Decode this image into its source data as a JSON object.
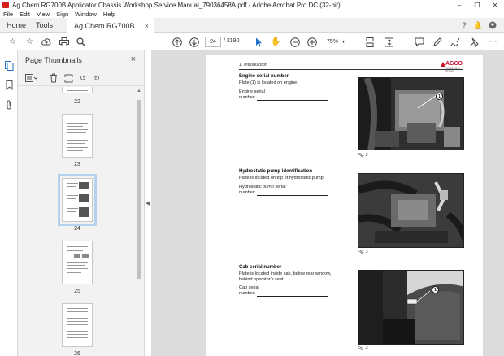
{
  "window": {
    "title": "Ag Chem RG700B Applicator Chassis Workshop Service Manual_79036458A.pdf - Adobe Acrobat Pro DC (32-bit)",
    "controls": [
      "–",
      "❐",
      "✕"
    ]
  },
  "menu": [
    "File",
    "Edit",
    "View",
    "Sign",
    "Window",
    "Help"
  ],
  "tabs": {
    "home": "Home",
    "tools": "Tools",
    "document": "Ag Chem RG700B ...",
    "close": "×"
  },
  "toolbar": {
    "current_page": "24",
    "total_pages": "/ 2190",
    "zoom": "75%"
  },
  "thumbnails": {
    "title": "Page Thumbnails",
    "close": "×",
    "pages": [
      {
        "label": "22"
      },
      {
        "label": "23"
      },
      {
        "label": "24",
        "selected": true
      },
      {
        "label": "25"
      },
      {
        "label": "26"
      }
    ]
  },
  "document": {
    "section": "1. Introduction",
    "logo": "AGCO",
    "logo_sub": "Your Agriculture Company",
    "blocks": [
      {
        "title": "Engine serial number",
        "text": "Plate (1) is located on engine.",
        "field_label_1": "Engine serial",
        "field_label_2": "number:",
        "figure": "Fig. 2",
        "callout": "1"
      },
      {
        "title": "Hydrostatic pump identification",
        "text": "Plate is located on top of hydrostatic pump.",
        "field_label_1": "Hydrostatic pump serial",
        "field_label_2": "number:",
        "figure": "Fig. 3"
      },
      {
        "title": "Cab serial number",
        "text": "Plate is located inside cab, below rear window,",
        "text2": "behind operator’s seat.",
        "field_label_1": "Cab serial",
        "field_label_2": "number:",
        "figure": "Fig. 4",
        "callout": "1"
      }
    ]
  }
}
